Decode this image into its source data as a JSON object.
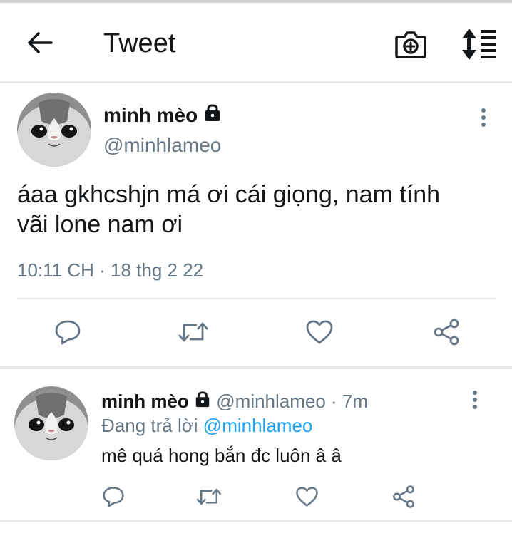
{
  "header": {
    "title": "Tweet",
    "icons": [
      "back-arrow-icon",
      "camera-add-icon",
      "sort-icon"
    ]
  },
  "main_tweet": {
    "name": "minh mèo",
    "handle": "@minhlameo",
    "text_line1": "áaa gkhcshjn má ơi cái giọng, nam tính",
    "text_line2": "vãi lone nam ơi",
    "timestamp": "10:11 CH · 18 thg 2 22"
  },
  "reply": {
    "name": "minh mèo",
    "meta": "@minhlameo · 7m",
    "replying_prefix": "Đang trả lời",
    "replying_to": "@minhlameo",
    "text": "mê quá hong bắn đc luôn â â"
  },
  "colors": {
    "text_primary": "#14171a",
    "text_secondary": "#657786",
    "accent": "#1da1f2",
    "divider": "#e6e9eb"
  }
}
